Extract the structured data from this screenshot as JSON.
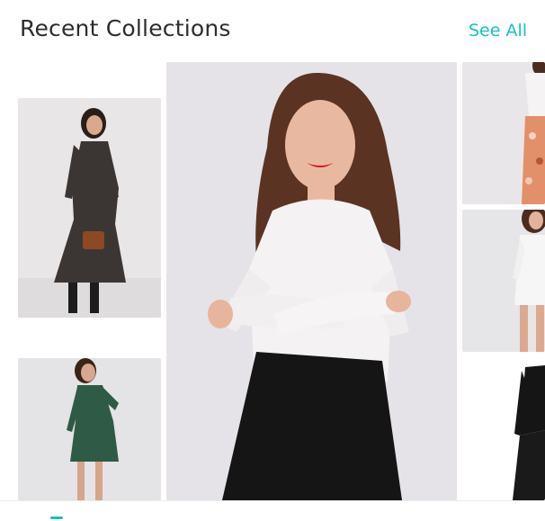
{
  "header": {
    "title": "Recent Collections",
    "see_all_label": "See All"
  },
  "colors": {
    "accent": "#17c1c1",
    "title": "#2d2d2d",
    "card_bg": "#e6e5e9"
  },
  "collections": [
    {
      "name": "collection-item-1",
      "image": "model-black-floral-dress-with-handbag-photo"
    },
    {
      "name": "collection-item-2",
      "image": "model-green-floral-dress-photo"
    },
    {
      "name": "collection-item-featured",
      "image": "model-white-top-black-pants-photo"
    },
    {
      "name": "collection-item-4",
      "image": "model-floral-skirt-photo"
    },
    {
      "name": "collection-item-5",
      "image": "model-white-dress-photo"
    },
    {
      "name": "collection-item-6",
      "image": "model-black-outfit-photo"
    }
  ]
}
